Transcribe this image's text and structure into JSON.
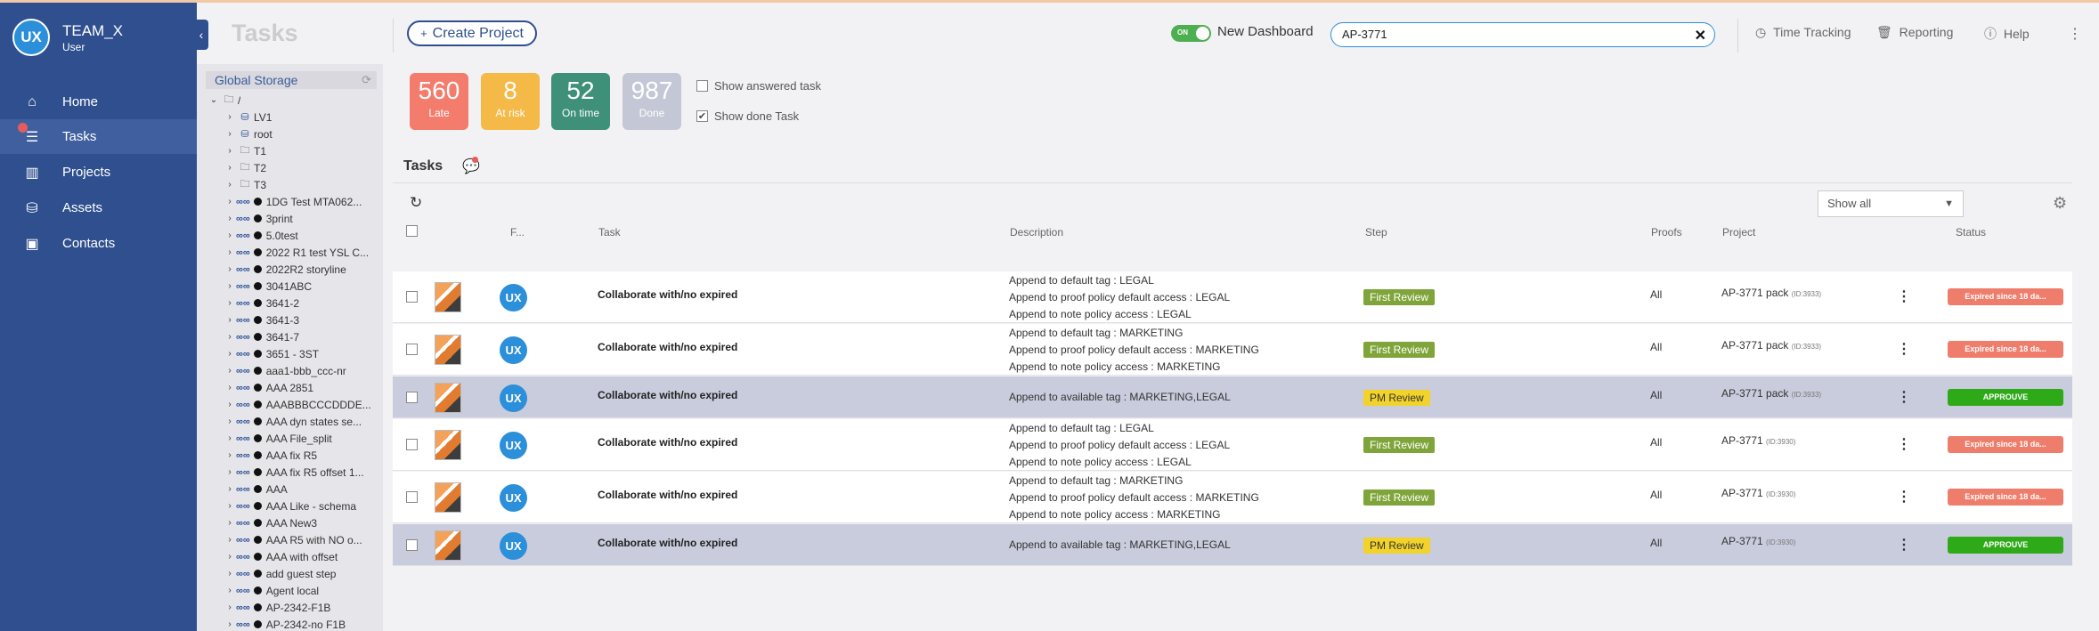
{
  "app": {
    "avatar_initials": "UX",
    "team_name": "TEAM_X",
    "user_role": "User"
  },
  "nav": {
    "items": [
      {
        "label": "Home",
        "icon": "home-icon"
      },
      {
        "label": "Tasks",
        "icon": "tasks-icon"
      },
      {
        "label": "Projects",
        "icon": "projects-icon"
      },
      {
        "label": "Assets",
        "icon": "assets-icon"
      },
      {
        "label": "Contacts",
        "icon": "contacts-icon"
      }
    ],
    "active": "Tasks"
  },
  "tree": {
    "header": "Global Storage",
    "root": "/",
    "folders": [
      "LV1",
      "root",
      "T1",
      "T2",
      "T3"
    ],
    "items": [
      "1DG Test MTA062...",
      "3print",
      "5.0test",
      "2022 R1 test YSL C...",
      "2022R2 storyline",
      "3041ABC",
      "3641-2",
      "3641-3",
      "3641-7",
      "3651 - 3ST",
      "aaa1-bbb_ccc-nr",
      "AAA 2851",
      "AAABBBCCCDDDE...",
      "AAA dyn states se...",
      "AAA File_split",
      "AAA fix R5",
      "AAA fix R5 offset 1...",
      "AAA",
      "AAA Like - schema",
      "AAA New3",
      "AAA R5 with NO o...",
      "AAA with offset",
      "add guest step",
      "Agent local",
      "AP-2342-F1B",
      "AP-2342-no F1B"
    ]
  },
  "header": {
    "page_title": "Tasks",
    "create_project": "Create Project",
    "toggle_label": "ON",
    "new_dashboard": "New Dashboard",
    "search_value": "AP-3771",
    "time_tracking": "Time Tracking",
    "reporting": "Reporting",
    "help": "Help"
  },
  "counters": [
    {
      "value": "560",
      "label": "Late",
      "color": "#f47c6c"
    },
    {
      "value": "8",
      "label": "At risk",
      "color": "#f5b947"
    },
    {
      "value": "52",
      "label": "On time",
      "color": "#3f9079"
    },
    {
      "value": "987",
      "label": "Done",
      "color": "#c4c8d6"
    }
  ],
  "filters": {
    "show_answered": "Show answered task",
    "show_done": "Show done Task"
  },
  "tasks_section": {
    "title": "Tasks",
    "show_all": "Show all"
  },
  "columns": [
    "F...",
    "Task",
    "Description",
    "Step",
    "Proofs",
    "Project",
    "Status"
  ],
  "rows": [
    {
      "task": "Collaborate with/no expired",
      "desc": [
        "Append to default tag : LEGAL",
        "Append to proof policy default access : LEGAL",
        "Append to note policy access : LEGAL"
      ],
      "step": "First Review",
      "proofs": "All",
      "project": "AP-3771 pack",
      "project_id": "(ID:3933)",
      "status": "Expired since 18 da...",
      "highlight": false
    },
    {
      "task": "Collaborate with/no expired",
      "desc": [
        "Append to default tag : MARKETING",
        "Append to proof policy default access : MARKETING",
        "Append to note policy access : MARKETING"
      ],
      "step": "First Review",
      "proofs": "All",
      "project": "AP-3771 pack",
      "project_id": "(ID:3933)",
      "status": "Expired since 18 da...",
      "highlight": false
    },
    {
      "task": "Collaborate with/no expired",
      "desc": [
        "Append to available tag : MARKETING,LEGAL"
      ],
      "step": "PM Review",
      "proofs": "All",
      "project": "AP-3771 pack",
      "project_id": "(ID:3933)",
      "status": "APPROUVE",
      "highlight": true
    },
    {
      "task": "Collaborate with/no expired",
      "desc": [
        "Append to default tag : LEGAL",
        "Append to proof policy default access : LEGAL",
        "Append to note policy access : LEGAL"
      ],
      "step": "First Review",
      "proofs": "All",
      "project": "AP-3771",
      "project_id": "(ID:3930)",
      "status": "Expired since 18 da...",
      "highlight": false
    },
    {
      "task": "Collaborate with/no expired",
      "desc": [
        "Append to default tag : MARKETING",
        "Append to proof policy default access : MARKETING",
        "Append to note policy access : MARKETING"
      ],
      "step": "First Review",
      "proofs": "All",
      "project": "AP-3771",
      "project_id": "(ID:3930)",
      "status": "Expired since 18 da...",
      "highlight": false
    },
    {
      "task": "Collaborate with/no expired",
      "desc": [
        "Append to available tag : MARKETING,LEGAL"
      ],
      "step": "PM Review",
      "proofs": "All",
      "project": "AP-3771",
      "project_id": "(ID:3930)",
      "status": "APPROUVE",
      "highlight": true
    }
  ],
  "row_avatar": "UX"
}
